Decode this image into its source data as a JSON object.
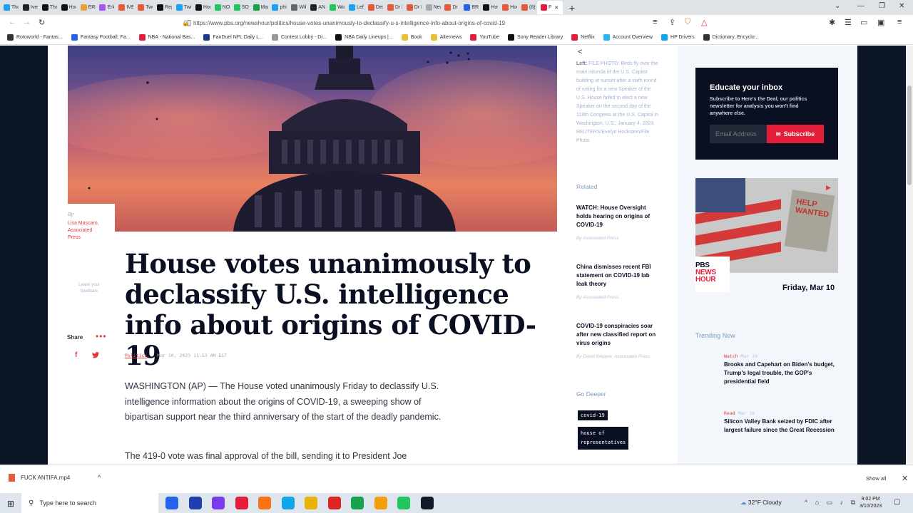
{
  "browser": {
    "tabs": [
      {
        "label": "Tho",
        "color": "#1da1f2"
      },
      {
        "label": "Iverr",
        "color": "#222"
      },
      {
        "label": "The",
        "color": "#111"
      },
      {
        "label": "How",
        "color": "#111"
      },
      {
        "label": "ERLC",
        "color": "#e8a23a"
      },
      {
        "label": "Erlc",
        "color": "#a855f7"
      },
      {
        "label": "IVEF",
        "color": "#e35b3a"
      },
      {
        "label": "Two",
        "color": "#e35b3a"
      },
      {
        "label": "Rep",
        "color": "#111"
      },
      {
        "label": "Twit",
        "color": "#1da1f2"
      },
      {
        "label": "Hon",
        "color": "#111"
      },
      {
        "label": "NOT",
        "color": "#22c55e"
      },
      {
        "label": "SO I",
        "color": "#22c55e"
      },
      {
        "label": "Mar",
        "color": "#16a34a"
      },
      {
        "label": "phil",
        "color": "#1da1f2"
      },
      {
        "label": "Wik",
        "color": "#666"
      },
      {
        "label": "ANT",
        "color": "#222"
      },
      {
        "label": "Wor",
        "color": "#22c55e"
      },
      {
        "label": "Left",
        "color": "#1da1f2"
      },
      {
        "label": "Dex",
        "color": "#e35b3a"
      },
      {
        "label": "Dr M",
        "color": "#e35b3a"
      },
      {
        "label": "Dr M",
        "color": "#e35b3a"
      },
      {
        "label": "New Tab",
        "color": "#aaa"
      },
      {
        "label": "Dr M",
        "color": "#e35b3a"
      },
      {
        "label": "BRE",
        "color": "#2563eb"
      },
      {
        "label": "How",
        "color": "#111"
      },
      {
        "label": "Hou",
        "color": "#e35b3a"
      },
      {
        "label": "(8)",
        "color": "#e35b3a"
      },
      {
        "label": "F",
        "color": "#e41e3a",
        "active": true
      }
    ],
    "new_tab": "+",
    "url": "https://www.pbs.org/newshour/politics/house-votes-unanimously-to-declassify-u-s-intelligence-info-about-origins-of-covid-19",
    "bookmarks": [
      {
        "label": "Rotoworld - Fantas...",
        "color": "#333"
      },
      {
        "label": "Fantasy Football, Fa...",
        "color": "#2563eb"
      },
      {
        "label": "NBA - National Bas...",
        "color": "#e41e3a"
      },
      {
        "label": "FanDuel NFL Daily L...",
        "color": "#1e3a8a"
      },
      {
        "label": "Contest Lobby - Dr...",
        "color": "#999"
      },
      {
        "label": "NBA Daily Lineups |...",
        "color": "#111"
      },
      {
        "label": "Book",
        "color": "#e8c13a"
      },
      {
        "label": "Alternews",
        "color": "#e8c13a"
      },
      {
        "label": "YouTube",
        "color": "#e41e3a"
      },
      {
        "label": "Sony Reader Library",
        "color": "#111"
      },
      {
        "label": "Netflix",
        "color": "#e41e3a"
      },
      {
        "label": "Account Overview",
        "color": "#29b6f6"
      },
      {
        "label": "HP Drivers",
        "color": "#0ea5e9"
      },
      {
        "label": "Dictionary, Encyclo...",
        "color": "#333"
      }
    ]
  },
  "article": {
    "byline_prefix": "By",
    "author": "Lisa Mascaro, Associated Press",
    "feedback": "Leave your feedback",
    "share_label": "Share",
    "share_more": "•••",
    "facebook": "f",
    "twitter": "t",
    "headline": "House votes unanimously to declassify U.S. intelligence info about origins of COVID-19",
    "category": "Politics",
    "timestamp": "Mar 10, 2023 11:53 AM EST",
    "paragraph1": "WASHINGTON (AP) — The House voted unanimously Friday to declassify U.S. intelligence information about the origins of COVID-19, a sweeping show of bipartisan support near the third anniversary of the start of the deadly pandemic.",
    "paragraph2": "The 419-0 vote was final approval of the bill, sending it to President Joe"
  },
  "sidebar": {
    "back": "<",
    "caption_lead": "Left:",
    "caption": "FILE PHOTO: Birds fly over the main rotunda of the U.S. Capitol building at sunset after a sixth round of voting for a new Speaker of the U.S. House failed to elect a new Speaker on the second day of the 118th Congress at the U.S. Capitol in Washington, U.S., January 4, 2023. REUTERS/Evelyn Hockstein/File Photo",
    "related_title": "Related",
    "related": [
      {
        "title": "WATCH: House Oversight holds hearing on origins of COVID-19",
        "author": "By Associated Press"
      },
      {
        "title": "China dismisses recent FBI statement on COVID-19 lab leak theory",
        "author": "By Associated Press"
      },
      {
        "title": "COVID-19 conspiracies soar after new classified report on virus origins",
        "author": "By David Klepper, Associated Press"
      }
    ],
    "go_deeper": "Go Deeper",
    "tags": [
      "covid-19",
      "house of",
      "representatives"
    ]
  },
  "rightcol": {
    "newsletter_title": "Educate your inbox",
    "newsletter_desc": "Subscribe to Here's the Deal, our politics newsletter for analysis you won't find anywhere else.",
    "email_placeholder": "Email Address",
    "subscribe": "Subscribe",
    "sign_text": "HELP WANTED",
    "logo_pbs": "PBS",
    "logo_news": "NEWS",
    "logo_hour": "HOUR",
    "video_date": "Friday, Mar 10",
    "trending_title": "Trending Now",
    "trending": [
      {
        "kind": "Watch",
        "date": "Mar 10",
        "title": "Brooks and Capehart on Biden's budget, Trump's legal trouble, the GOP's presidential field"
      },
      {
        "kind": "Read",
        "date": "Mar 10",
        "title": "Silicon Valley Bank seized by FDIC after largest failure since the Great Recession"
      }
    ]
  },
  "downloads": {
    "file": "FUCK ANTIFA.mp4",
    "show_all": "Show all"
  },
  "taskbar": {
    "search_placeholder": "Type here to search",
    "weather": "32°F  Cloudy",
    "time": "9:02 PM",
    "date": "3/10/2023",
    "apps": [
      "#2563eb",
      "#1e40af",
      "#7c3aed",
      "#e41e3a",
      "#f97316",
      "#0ea5e9",
      "#eab308",
      "#dc2626",
      "#16a34a",
      "#f59e0b",
      "#22c55e",
      "#111827"
    ]
  }
}
